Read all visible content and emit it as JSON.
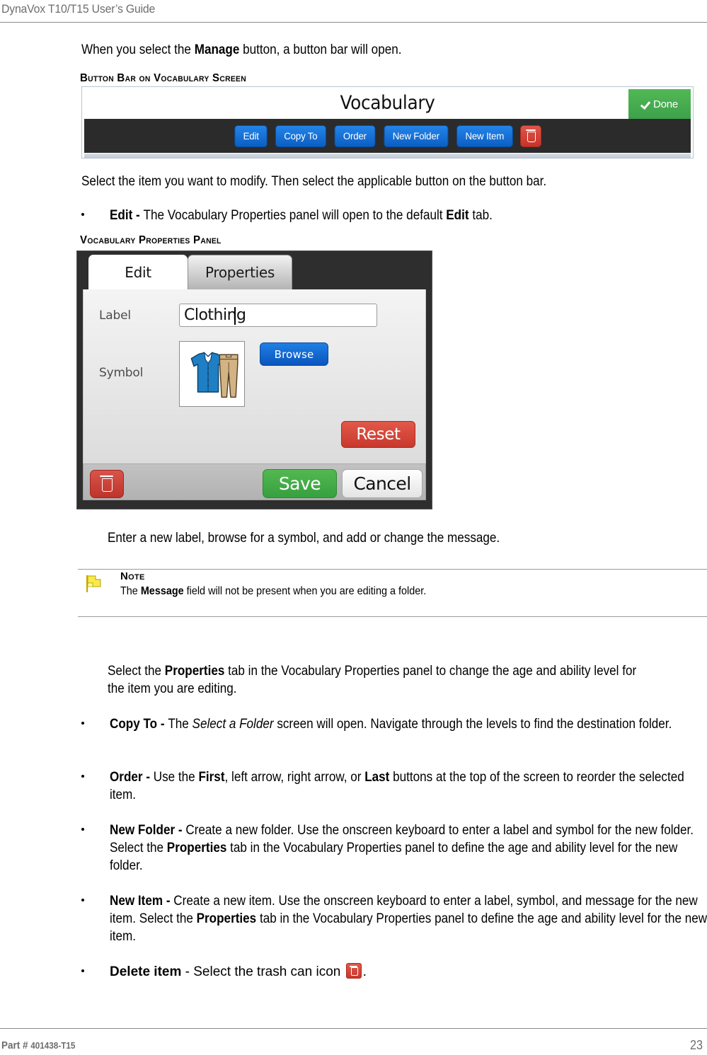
{
  "header": {
    "title": "DynaVox T10/T15 User’s Guide"
  },
  "footer": {
    "part_number_prefix": "Part # ",
    "part_number": "401438-T15",
    "page_number": "23"
  },
  "body": {
    "intro_paragraph_pre": "When you select the ",
    "intro_paragraph_bold": "Manage",
    "intro_paragraph_post": " button, a button bar will open.",
    "heading_button_bar": "Button Bar on Vocabulary Screen",
    "heading_properties_panel": "Vocabulary Properties Panel",
    "select_item_paragraph": "Select the item you want to modify. Then select the applicable button on the button bar.",
    "enter_label_paragraph": "Enter a new label, browse for a symbol, and add or change the message.",
    "properties_tab_paragraph_pre": "Select the ",
    "properties_tab_paragraph_bold": "Properties",
    "properties_tab_paragraph_post": " tab in the Vocabulary Properties panel to change the age and ability level for the item you are editing."
  },
  "note": {
    "icon": "flag-icon",
    "title": "Note",
    "text_pre": "The ",
    "text_bold": "Message",
    "text_post": " field will not be present when you are editing a folder."
  },
  "bullets": [
    {
      "term": "Edit - ",
      "text_pre": "The Vocabulary Properties panel will open to the default ",
      "text_bold": "Edit",
      "text_post": " tab."
    },
    {
      "term": "Copy To - ",
      "text_pre": "The ",
      "text_italic": "Select a Folder",
      "text_post": " screen will open. Navigate through the levels to find the destination folder."
    },
    {
      "term": "Order - ",
      "text_pre": "Use the ",
      "text_bold_1": "First",
      "text_mid": ", left arrow, right arrow, or ",
      "text_bold_2": "Last",
      "text_post": " buttons at the top of the screen to reorder the selected item."
    },
    {
      "term": "New Folder - ",
      "text_pre": "Create a new folder. Use the onscreen keyboard to enter a label and symbol for the new folder. Select the ",
      "text_bold": "Properties",
      "text_post": " tab in the Vocabulary Properties panel to define the age and ability level for the new folder."
    },
    {
      "term": "New Item - ",
      "text_pre": "Create a new item. Use the onscreen keyboard to enter a label, symbol, and message for the new item. Select the ",
      "text_bold": "Properties",
      "text_post": " tab in the Vocabulary Properties panel to define the age and ability level for the new item."
    },
    {
      "term": "Delete item",
      "text_pre": " - Select the trash can icon ",
      "icon": "trash-can-icon",
      "text_post": "."
    }
  ],
  "figure_button_bar": {
    "screen_title": "Vocabulary",
    "done_label": "Done",
    "done_icon": "checkmark-icon",
    "buttons": [
      {
        "label": "Edit"
      },
      {
        "label": "Copy To"
      },
      {
        "label": "Order"
      },
      {
        "label": "New Folder"
      },
      {
        "label": "New Item"
      }
    ],
    "trash_icon": "trash-can-icon",
    "colors": {
      "button_blue": "#1a74dd",
      "done_green": "#47ad4f",
      "trash_red": "#cc3b2f",
      "strip_dark": "#2b2b2b"
    }
  },
  "figure_properties_panel": {
    "tabs": [
      {
        "label": "Edit",
        "active": true
      },
      {
        "label": "Properties",
        "active": false
      }
    ],
    "fields": [
      {
        "label": "Label",
        "value": "Clothing"
      },
      {
        "label": "Symbol",
        "value": ""
      }
    ],
    "symbol_icon": "clothing-symbol-shirt-and-pants",
    "browse_label": "Browse",
    "reset_label": "Reset",
    "delete_icon": "trash-can-icon",
    "save_label": "Save",
    "cancel_label": "Cancel",
    "colors": {
      "save_green": "#45a84a",
      "reset_red": "#d14538",
      "browse_blue": "#1268d6",
      "panel_dark": "#2e2e2e"
    }
  }
}
